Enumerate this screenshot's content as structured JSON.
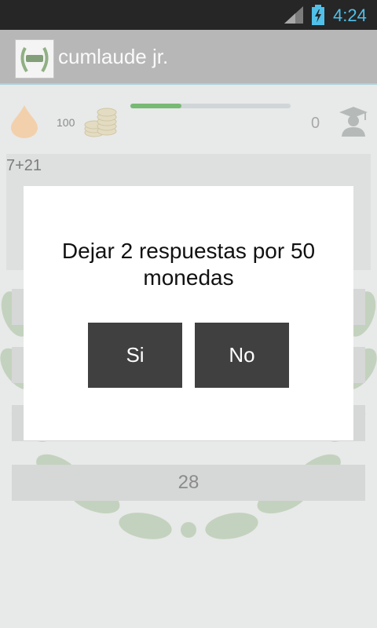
{
  "status": {
    "time": "4:24",
    "icons": [
      "signal-icon",
      "battery-charging-icon"
    ]
  },
  "app": {
    "title": "cumlaude jr.",
    "logo_icon": "laurel-logo-icon"
  },
  "hud": {
    "lives": "100",
    "score": "0",
    "progress_fraction": 0.32,
    "icons": [
      "drop-icon",
      "coins-icon",
      "graduate-icon"
    ]
  },
  "question": {
    "text": "7+21"
  },
  "answers": [
    {
      "label": ""
    },
    {
      "label": ""
    },
    {
      "label": ""
    },
    {
      "label": "28"
    }
  ],
  "dialog": {
    "message": "Dejar 2 respuestas por 50 monedas",
    "yes_label": "Si",
    "no_label": "No"
  },
  "colors": {
    "accent": "#33b5e5",
    "progress": "#5fae5b",
    "button": "#3f403f"
  }
}
